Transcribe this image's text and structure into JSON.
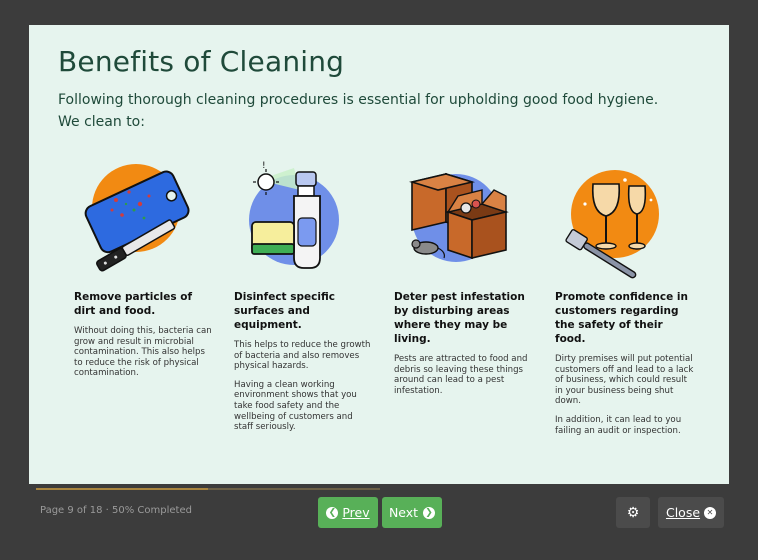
{
  "page": {
    "title": "Benefits of Cleaning",
    "intro_line1": "Following thorough cleaning procedures is essential for upholding good food hygiene.",
    "intro_line2": "We clean to:"
  },
  "columns": [
    {
      "icon": "cutting-board-knife-icon",
      "heading": "Remove particles of dirt and food.",
      "paragraphs": [
        "Without doing this, bacteria can grow and result in microbial contamination. This also helps to reduce the risk of physical contamination."
      ]
    },
    {
      "icon": "spray-bottle-sponge-icon",
      "heading": "Disinfect specific surfaces and equipment.",
      "paragraphs": [
        "This helps to reduce the growth of bacteria and also removes physical hazards.",
        "Having a clean working environment shows that you take food safety and the wellbeing of customers and staff seriously."
      ]
    },
    {
      "icon": "boxes-rat-icon",
      "heading": "Deter pest infestation by disturbing areas where they may be living.",
      "paragraphs": [
        "Pests are attracted to food and debris so leaving these things around can lead to a pest infestation."
      ]
    },
    {
      "icon": "glasses-fork-icon",
      "heading": "Promote confidence in customers regarding the safety of their food.",
      "paragraphs": [
        "Dirty premises will put potential customers off and lead to a lack of business, which could result in your business being shut down.",
        "In addition, it can lead to you failing an audit or inspection."
      ]
    }
  ],
  "footer": {
    "page_info": "Page 9 of 18 · 50% Completed",
    "progress_fraction": 0.5,
    "prev_label": "Prev",
    "next_label": "Next",
    "settings_icon": "gears-icon",
    "close_label": "Close"
  },
  "colors": {
    "accent_orange": "#f28a12",
    "accent_blue": "#6f8fe8",
    "button_green": "#58b058",
    "panel_bg": "#e6f4ee",
    "title_green": "#1f4a3a"
  }
}
